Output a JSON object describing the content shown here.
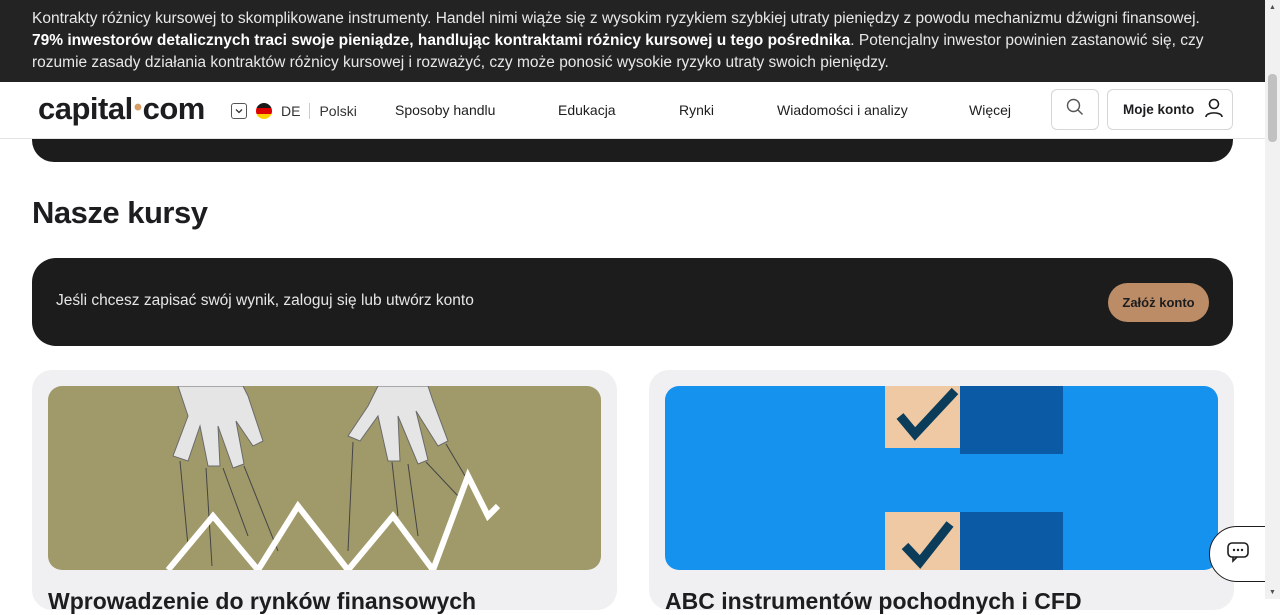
{
  "risk_warning": {
    "text_before": "Kontrakty różnicy kursowej to skomplikowane instrumenty. Handel nimi wiąże się z wysokim ryzykiem szybkiej utraty pieniędzy z powodu mechanizmu dźwigni finansowej. ",
    "text_bold": "79% inwestorów detalicznych traci swoje pieniądze, handlując kontraktami różnicy kursowej u tego pośrednika",
    "text_after": ". Potencjalny inwestor powinien zastanowić się, czy rozumie zasady działania kontraktów różnicy kursowej i rozważyć, czy może ponosić wysokie ryzyko utraty swoich pieniędzy."
  },
  "header": {
    "logo_left": "capital",
    "logo_dot": "•",
    "logo_right": "com",
    "region_code": "DE",
    "language": "Polski",
    "nav": [
      "Sposoby handlu",
      "Edukacja",
      "Rynki",
      "Wiadomości i analizy",
      "Więcej"
    ],
    "account_label": "Moje konto",
    "icons": [
      "chevron-down-icon",
      "germany-flag-icon",
      "search-icon",
      "user-icon"
    ]
  },
  "main": {
    "section_title": "Nasze kursy",
    "login_prompt": "Jeśli chcesz zapisać swój wynik, zaloguj się lub utwórz konto",
    "create_account_label": "Załóż konto",
    "courses": [
      {
        "title": "Wprowadzenie do rynków finansowych"
      },
      {
        "title": "ABC instrumentów pochodnych i CFD"
      }
    ]
  },
  "colors": {
    "banner_bg": "#232323",
    "dark_panel": "#1c1c1c",
    "accent": "#bc8c66",
    "card_bg": "#f0f0f2",
    "course1_img": "#a09a6a",
    "course2_img": "#1591ee"
  },
  "chat": {
    "icon": "chat-icon"
  }
}
